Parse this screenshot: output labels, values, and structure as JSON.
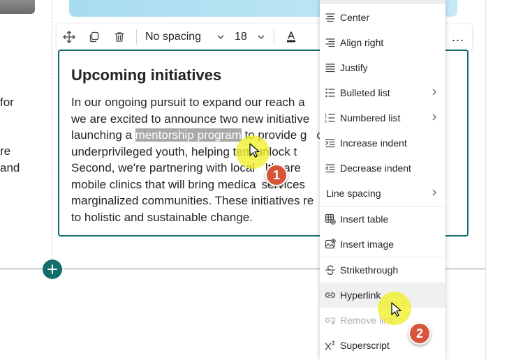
{
  "left_snippets": [
    {
      "text": "for"
    },
    {
      "text": "re"
    },
    {
      "text": "and"
    }
  ],
  "toolbar": {
    "style_label": "No spacing",
    "size_label": "18",
    "more_label": "..."
  },
  "text_box": {
    "heading": "Upcoming initiatives",
    "lines": [
      [
        "In our ongoing pursuit to expand our reach a"
      ],
      [
        "we are excited to announce two new initiative"
      ],
      [
        "launching a ",
        "mentorship program",
        " to provide g",
        "",
        "o"
      ],
      [
        "underprivileged youth, helping t",
        "",
        "em unlock t"
      ],
      [
        "Second, we're partnering with local ",
        "",
        "lthcare",
        "",
        "n"
      ],
      [
        "mobile clinics that will bring medica",
        "",
        "services"
      ],
      [
        "marginalized communities. These initiatives re"
      ],
      [
        "to holistic and sustainable change."
      ]
    ]
  },
  "menu": {
    "items": [
      {
        "label": "Center",
        "icon": "align-center-icon"
      },
      {
        "label": "Align right",
        "icon": "align-right-icon"
      },
      {
        "label": "Justify",
        "icon": "justify-icon"
      },
      {
        "label": "Bulleted list",
        "icon": "bulleted-list-icon",
        "submenu": true
      },
      {
        "label": "Numbered list",
        "icon": "numbered-list-icon",
        "submenu": true
      },
      {
        "label": "Increase indent",
        "icon": "increase-indent-icon"
      },
      {
        "label": "Decrease indent",
        "icon": "decrease-indent-icon"
      },
      {
        "label": "Line spacing",
        "icon": "",
        "submenu": true
      },
      {
        "label": "Insert table",
        "icon": "insert-table-icon"
      },
      {
        "label": "Insert image",
        "icon": "insert-image-icon"
      },
      {
        "label": "Strikethrough",
        "icon": "strikethrough-icon"
      },
      {
        "label": "Hyperlink",
        "icon": "hyperlink-icon",
        "hovered": true
      },
      {
        "label": "Remove link",
        "icon": "remove-link-icon",
        "disabled": true
      },
      {
        "label": "Superscript",
        "icon": "superscript-icon"
      }
    ]
  },
  "annotations": {
    "step1": "1",
    "step2": "2"
  },
  "colors": {
    "accent": "#136d6d",
    "badge": "#d9553a",
    "highlight": "#f0f028"
  }
}
